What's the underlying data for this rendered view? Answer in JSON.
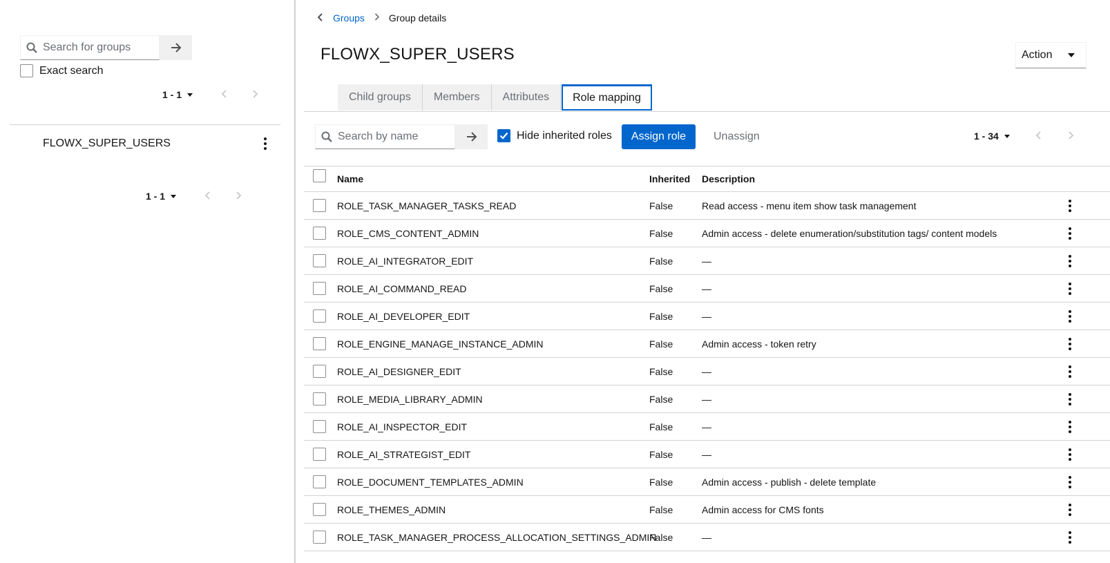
{
  "left": {
    "search_placeholder": "Search for groups",
    "exact_search_label": "Exact search",
    "pager_top": "1 - 1",
    "pager_bottom": "1 - 1",
    "tree_items": [
      "FLOWX_SUPER_USERS"
    ]
  },
  "breadcrumb": {
    "back": "‹",
    "groups": "Groups",
    "separator": "›",
    "current": "Group details"
  },
  "page_title": "FLOWX_SUPER_USERS",
  "action_label": "Action",
  "tabs": [
    "Child groups",
    "Members",
    "Attributes",
    "Role mapping"
  ],
  "active_tab": "Role mapping",
  "toolbar": {
    "search_placeholder": "Search by name",
    "hide_inherited_label": "Hide inherited roles",
    "hide_inherited_checked": true,
    "assign_label": "Assign role",
    "unassign_label": "Unassign",
    "pager": "1 - 34"
  },
  "table": {
    "headers": {
      "name": "Name",
      "inherited": "Inherited",
      "description": "Description"
    },
    "rows": [
      {
        "name": "ROLE_TASK_MANAGER_TASKS_READ",
        "inherited": "False",
        "description": "Read access - menu item show task management"
      },
      {
        "name": "ROLE_CMS_CONTENT_ADMIN",
        "inherited": "False",
        "description": "Admin access - delete enumeration/substitution tags/ content models"
      },
      {
        "name": "ROLE_AI_INTEGRATOR_EDIT",
        "inherited": "False",
        "description": "—"
      },
      {
        "name": "ROLE_AI_COMMAND_READ",
        "inherited": "False",
        "description": "—"
      },
      {
        "name": "ROLE_AI_DEVELOPER_EDIT",
        "inherited": "False",
        "description": "—"
      },
      {
        "name": "ROLE_ENGINE_MANAGE_INSTANCE_ADMIN",
        "inherited": "False",
        "description": "Admin access - token retry"
      },
      {
        "name": "ROLE_AI_DESIGNER_EDIT",
        "inherited": "False",
        "description": "—"
      },
      {
        "name": "ROLE_MEDIA_LIBRARY_ADMIN",
        "inherited": "False",
        "description": "—"
      },
      {
        "name": "ROLE_AI_INSPECTOR_EDIT",
        "inherited": "False",
        "description": "—"
      },
      {
        "name": "ROLE_AI_STRATEGIST_EDIT",
        "inherited": "False",
        "description": "—"
      },
      {
        "name": "ROLE_DOCUMENT_TEMPLATES_ADMIN",
        "inherited": "False",
        "description": "Admin access - publish - delete template"
      },
      {
        "name": "ROLE_THEMES_ADMIN",
        "inherited": "False",
        "description": "Admin access for CMS fonts"
      },
      {
        "name": "ROLE_TASK_MANAGER_PROCESS_ALLOCATION_SETTINGS_ADMIN",
        "inherited": "False",
        "description": "—"
      }
    ]
  },
  "colors": {
    "accent": "#0066cc",
    "border": "#d2d2d2",
    "muted": "#6a6e73"
  }
}
